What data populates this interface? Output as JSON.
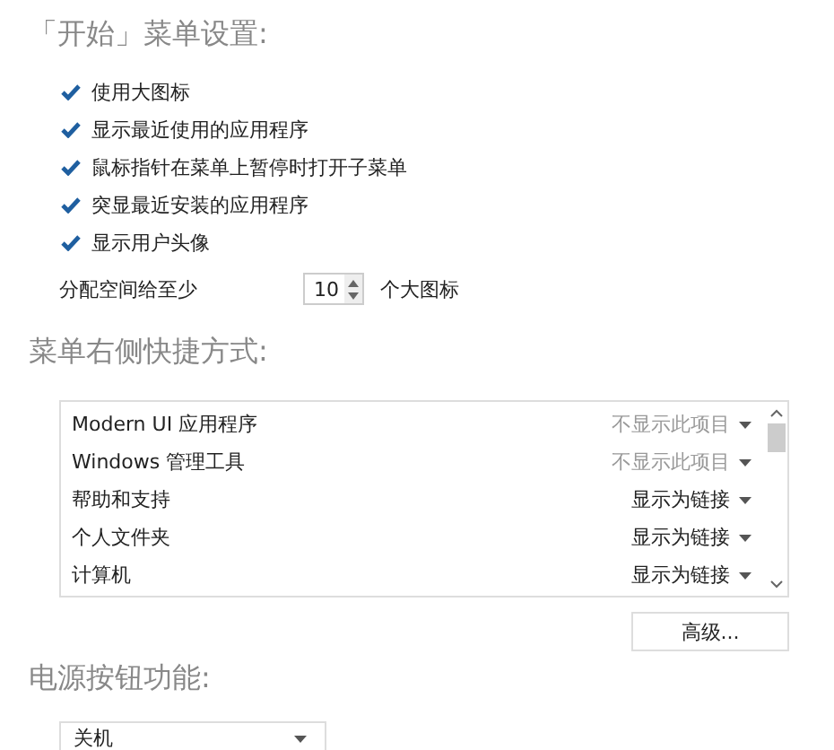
{
  "start_menu": {
    "heading": "「开始」菜单设置:",
    "options": [
      {
        "label": "使用大图标",
        "checked": true
      },
      {
        "label": "显示最近使用的应用程序",
        "checked": true
      },
      {
        "label": "鼠标指针在菜单上暂停时打开子菜单",
        "checked": true
      },
      {
        "label": "突显最近安装的应用程序",
        "checked": true
      },
      {
        "label": "显示用户头像",
        "checked": true
      }
    ],
    "space": {
      "label": "分配空间给至少",
      "value": "10",
      "unit": "个大图标"
    }
  },
  "shortcuts": {
    "heading": "菜单右侧快捷方式:",
    "rows": [
      {
        "name": "Modern UI 应用程序",
        "setting": "不显示此项目",
        "muted": true
      },
      {
        "name": "Windows 管理工具",
        "setting": "不显示此项目",
        "muted": true
      },
      {
        "name": "帮助和支持",
        "setting": "显示为链接",
        "muted": false
      },
      {
        "name": "个人文件夹",
        "setting": "显示为链接",
        "muted": false
      },
      {
        "name": "计算机",
        "setting": "显示为链接",
        "muted": false
      }
    ],
    "advanced_button": "高级..."
  },
  "power": {
    "heading": "电源按钮功能:",
    "value": "关机"
  }
}
